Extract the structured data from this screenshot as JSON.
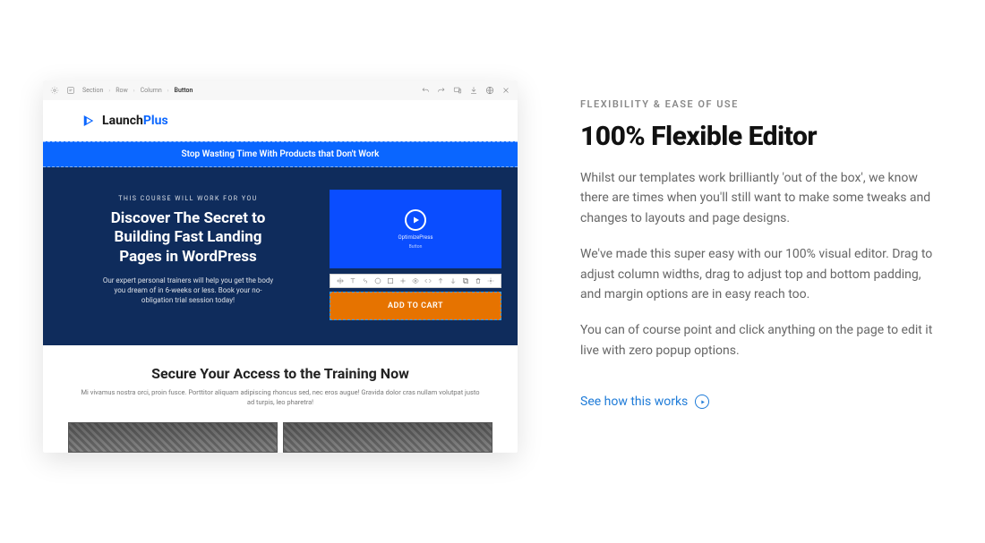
{
  "editor": {
    "breadcrumb": [
      "Section",
      "Row",
      "Column",
      "Button"
    ]
  },
  "launchplus": {
    "name_part1": "Launch",
    "name_part2": "Plus"
  },
  "strip": "Stop Wasting Time With Products that Don't Work",
  "hero": {
    "eyebrow": "THIS COURSE WILL WORK FOR YOU",
    "title": "Discover The Secret to Building Fast Landing Pages in WordPress",
    "sub": "Our expert personal trainers will help you get the body you dream of in 6-weeks or less.  Book your no-obligation trial session today!"
  },
  "video": {
    "brand": "OptimizePress",
    "sub": "Button"
  },
  "cta": "ADD TO CART",
  "secure": {
    "title": "Secure Your Access to the Training Now",
    "sub": "Mi vivamus nostra orci, proin fusce. Porttitor aliquam adipiscing rhoncus sed, nec eros augue! Gravida dolor cras nullam volutpat justo ad turpis, leo pharetra!"
  },
  "marketing": {
    "eyebrow": "FLEXIBILITY & EASE OF USE",
    "headline": "100% Flexible Editor",
    "p1": "Whilst our templates work brilliantly 'out of the box', we know there are times when you'll still want to make some tweaks and changes to layouts and page designs.",
    "p2": "We've made this super easy with our 100% visual editor.  Drag to adjust column widths, drag to adjust top and bottom padding, and margin options are in easy reach too.",
    "p3": "You can of course point and click anything on the page to edit it live with zero popup options.",
    "link": "See how this works"
  }
}
